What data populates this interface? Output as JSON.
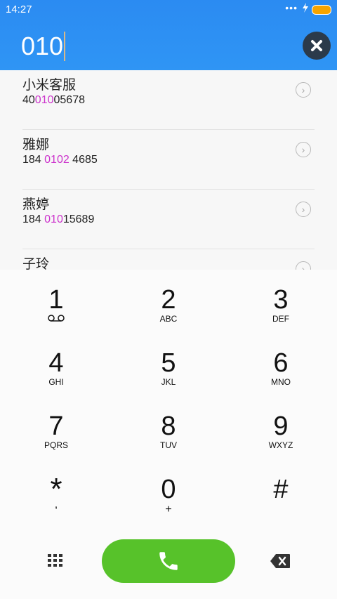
{
  "status_bar": {
    "time": "14:27",
    "dots": "•••",
    "battery_color": "#f7a400"
  },
  "dialer": {
    "input_value": "010"
  },
  "results": [
    {
      "name": "小米客服",
      "num_pre": "40",
      "num_hl": "010",
      "num_post": "05678"
    },
    {
      "name": "雅娜",
      "num_pre": "184 ",
      "num_hl": "0102",
      "num_post": " 4685"
    },
    {
      "name": "燕婷",
      "num_pre": "184 ",
      "num_hl": "010",
      "num_post": "15689"
    },
    {
      "name": "子玲",
      "num_pre": "",
      "num_hl": "",
      "num_post": ""
    }
  ],
  "keypad": [
    {
      "digit": "1",
      "letters": ""
    },
    {
      "digit": "2",
      "letters": "ABC"
    },
    {
      "digit": "3",
      "letters": "DEF"
    },
    {
      "digit": "4",
      "letters": "GHI"
    },
    {
      "digit": "5",
      "letters": "JKL"
    },
    {
      "digit": "6",
      "letters": "MNO"
    },
    {
      "digit": "7",
      "letters": "PQRS"
    },
    {
      "digit": "8",
      "letters": "TUV"
    },
    {
      "digit": "9",
      "letters": "WXYZ"
    },
    {
      "digit": "*",
      "letters": ","
    },
    {
      "digit": "0",
      "letters": "+"
    },
    {
      "digit": "#",
      "letters": ""
    }
  ],
  "colors": {
    "header": "#2f95f4",
    "call_button": "#57c22a",
    "highlight": "#cc33cc"
  }
}
